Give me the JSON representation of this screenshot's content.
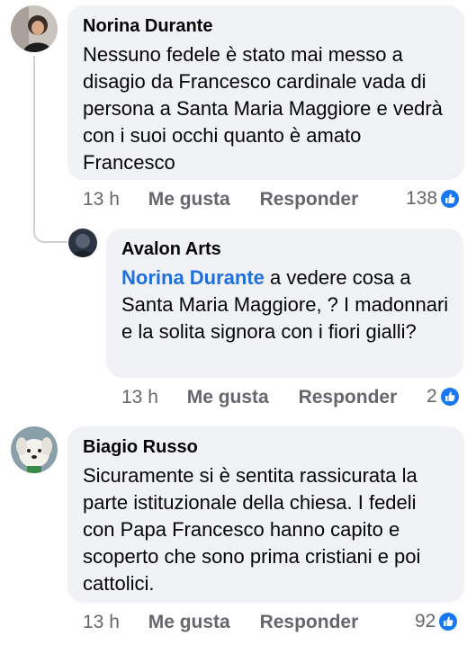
{
  "comments": [
    {
      "author": "Norina Durante",
      "text": "Nessuno fedele è stato mai messo a disagio da Francesco cardinale vada di persona a Santa Maria Maggiore e vedrà con i suoi occhi quanto è amato Francesco",
      "time": "13 h",
      "like_label": "Me gusta",
      "reply_label": "Responder",
      "reactions": "138"
    },
    {
      "author": "Avalon Arts",
      "mention": "Norina Durante",
      "text": " a vedere cosa a Santa Maria Maggiore, ? I madonnari e la solita signora con i fiori gialli?",
      "time": "13 h",
      "like_label": "Me gusta",
      "reply_label": "Responder",
      "reactions": "2"
    },
    {
      "author": "Biagio Russo",
      "text": "Sicuramente si è sentita rassicurata la parte  istituzionale della chiesa. I fedeli con Papa Francesco hanno capito e scoperto che sono prima cristiani e poi cattolici.",
      "time": "13 h",
      "like_label": "Me gusta",
      "reply_label": "Responder",
      "reactions": "92"
    }
  ],
  "colors": {
    "bubble": "#f0f2f5",
    "mention": "#216fdb",
    "meta": "#65676b",
    "like": "#1877f2"
  },
  "icons": {
    "reaction": "like-icon"
  }
}
